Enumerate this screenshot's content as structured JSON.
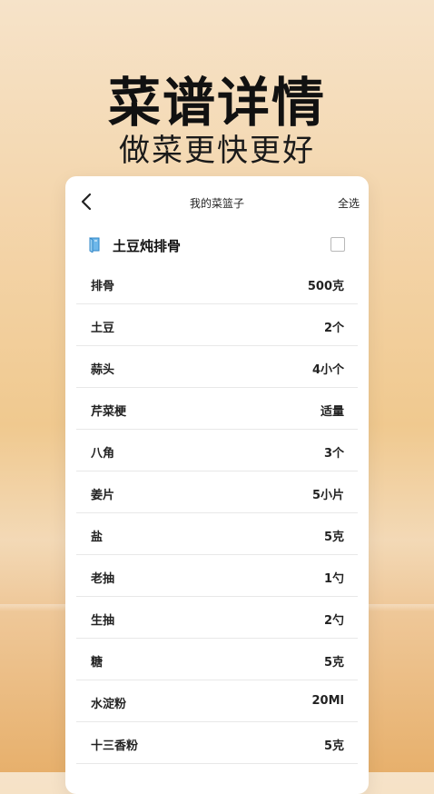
{
  "hero": {
    "title": "菜谱详情",
    "subtitle": "做菜更快更好"
  },
  "topbar": {
    "title": "我的菜篮子",
    "select_all": "全选"
  },
  "recipe": {
    "name": "土豆炖排骨",
    "icon": "book-icon",
    "checked": false
  },
  "ingredients": [
    {
      "name": "排骨",
      "qty": "500克"
    },
    {
      "name": "土豆",
      "qty": "2个"
    },
    {
      "name": "蒜头",
      "qty": "4小个"
    },
    {
      "name": "芹菜梗",
      "qty": "适量"
    },
    {
      "name": "八角",
      "qty": "3个"
    },
    {
      "name": "姜片",
      "qty": "5小片"
    },
    {
      "name": "盐",
      "qty": "5克"
    },
    {
      "name": "老抽",
      "qty": "1勺"
    },
    {
      "name": "生抽",
      "qty": "2勺"
    },
    {
      "name": "糖",
      "qty": "5克"
    },
    {
      "name": "水淀粉",
      "qty": "20Ml"
    },
    {
      "name": "十三香粉",
      "qty": "5克"
    }
  ],
  "colors": {
    "card_bg": "#ffffff",
    "divider": "#e8e8e8",
    "icon_blue": "#4aa3df"
  }
}
